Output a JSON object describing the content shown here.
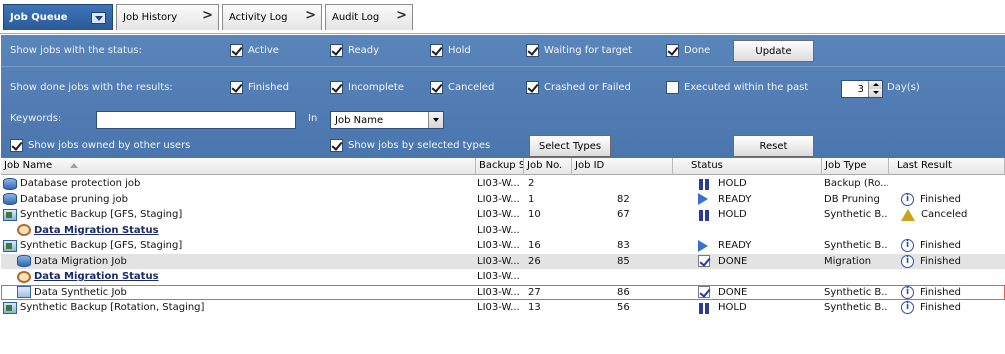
{
  "tabs": [
    {
      "label": "Job Queue",
      "active": true
    },
    {
      "label": "Job History"
    },
    {
      "label": "Activity Log"
    },
    {
      "label": "Audit Log"
    }
  ],
  "filter": {
    "status_label": "Show jobs with the status:",
    "status_options": [
      {
        "label": "Active",
        "checked": true
      },
      {
        "label": "Ready",
        "checked": true
      },
      {
        "label": "Hold",
        "checked": true
      },
      {
        "label": "Waiting for target",
        "checked": true
      },
      {
        "label": "Done",
        "checked": true
      }
    ],
    "update_button": "Update",
    "results_label": "Show done jobs with the results:",
    "result_options": [
      {
        "label": "Finished",
        "checked": true
      },
      {
        "label": "Incomplete",
        "checked": true
      },
      {
        "label": "Canceled",
        "checked": true
      },
      {
        "label": "Crashed or Failed",
        "checked": true
      },
      {
        "label": "Executed within the past",
        "checked": false
      }
    ],
    "days_value": "3",
    "days_unit": "Day(s)",
    "keywords_label": "Keywords:",
    "keywords_value": "",
    "in_label": "In",
    "in_select_value": "Job Name",
    "show_other_users_label": "Show jobs owned by other users",
    "show_other_users_checked": true,
    "show_selected_types_label": "Show jobs by selected types",
    "show_selected_types_checked": true,
    "select_types_button": "Select Types",
    "reset_button": "Reset"
  },
  "columns": [
    "Job Name",
    "Backup Se...",
    "Job No.",
    "Job ID",
    "Status",
    "Job Type",
    "Last Result"
  ],
  "rows": [
    {
      "name": "Database protection job",
      "icon": "database-icon",
      "backup": "LI03-W...",
      "no": "2",
      "id": "",
      "status": "HOLD",
      "status_icon": "hold-icon",
      "type": "Backup (Ro...",
      "result": ""
    },
    {
      "name": "Database pruning job",
      "icon": "database-icon",
      "backup": "LI03-W...",
      "no": "1",
      "id": "82",
      "status": "READY",
      "status_icon": "ready-icon",
      "type": "DB Pruning",
      "result": "Finished",
      "result_icon": "finished-icon"
    },
    {
      "name": "Synthetic Backup [GFS, Staging]",
      "icon": "synthetic-backup-icon",
      "backup": "LI03-W...",
      "no": "10",
      "id": "67",
      "status": "HOLD",
      "status_icon": "hold-icon",
      "type": "Synthetic B...",
      "result": "Canceled",
      "result_icon": "canceled-icon"
    },
    {
      "name": "Data Migration Status",
      "icon": "migration-status-icon",
      "bold": true,
      "indent": true,
      "backup": "LI03-W...",
      "no": "",
      "id": "",
      "status": "",
      "type": "",
      "result": ""
    },
    {
      "name": "Synthetic Backup [GFS, Staging]",
      "icon": "synthetic-backup-icon",
      "backup": "LI03-W...",
      "no": "16",
      "id": "83",
      "status": "READY",
      "status_icon": "ready-icon",
      "type": "Synthetic B...",
      "result": "Finished",
      "result_icon": "finished-icon"
    },
    {
      "name": "Data Migration Job",
      "icon": "database-icon",
      "indent": true,
      "shaded": true,
      "backup": "LI03-W...",
      "no": "26",
      "id": "85",
      "status": "DONE",
      "status_icon": "done-icon",
      "type": "Migration",
      "result": "Finished",
      "result_icon": "finished-icon"
    },
    {
      "name": "Data Migration Status",
      "icon": "migration-status-icon",
      "bold": true,
      "indent": true,
      "backup": "LI03-W...",
      "no": "",
      "id": "",
      "status": "",
      "type": "",
      "result": ""
    },
    {
      "name": "Data Synthetic Job",
      "icon": "data-job-icon",
      "indent": true,
      "framed": true,
      "backup": "LI03-W...",
      "no": "27",
      "id": "86",
      "status": "DONE",
      "status_icon": "done-icon",
      "type": "Synthetic B...",
      "result": "Finished",
      "result_icon": "finished-icon"
    },
    {
      "name": "Synthetic Backup [Rotation, Staging]",
      "icon": "synthetic-backup-icon",
      "backup": "LI03-W...",
      "no": "13",
      "id": "56",
      "status": "HOLD",
      "status_icon": "hold-icon",
      "type": "Synthetic B...",
      "result": "Finished",
      "result_icon": "finished-icon"
    }
  ]
}
